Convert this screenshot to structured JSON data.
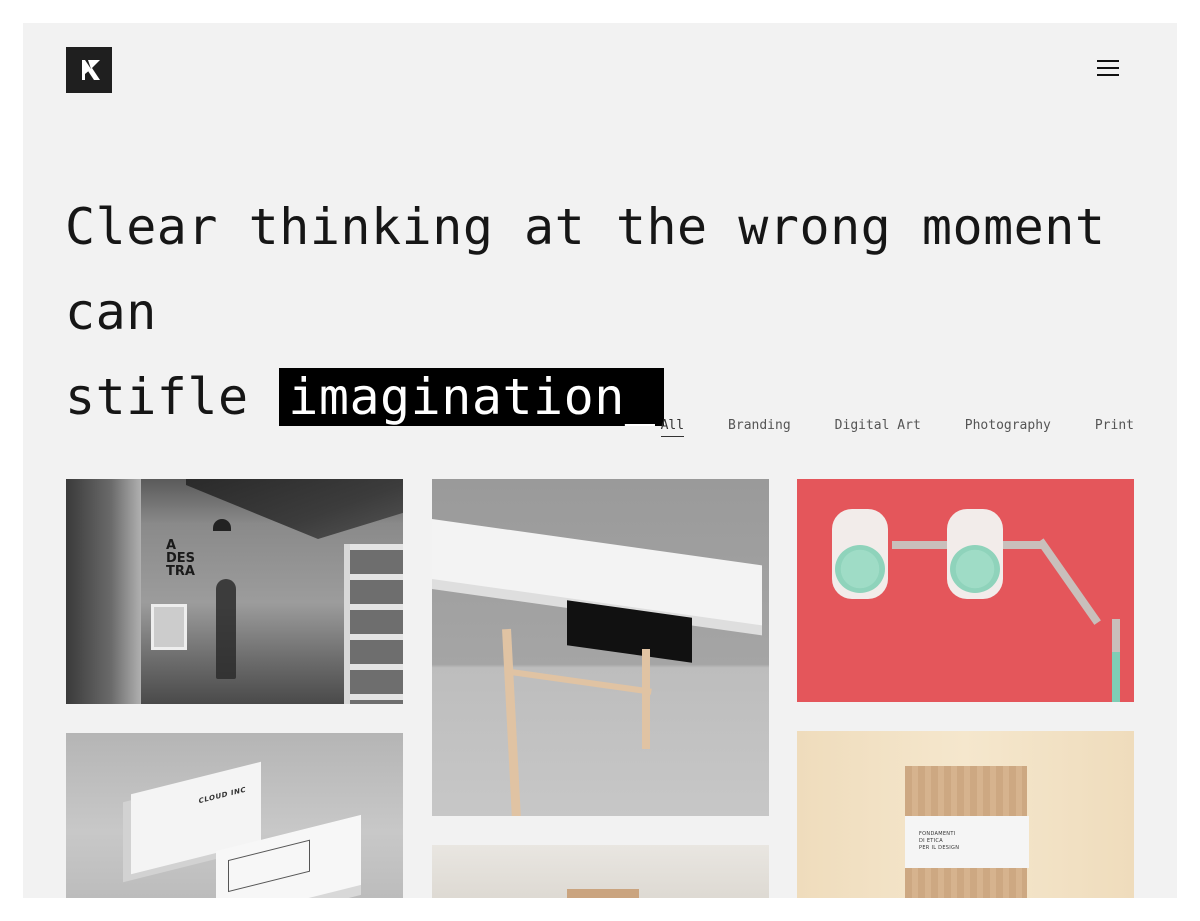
{
  "header": {
    "logo_letter": "K",
    "menu_icon": "hamburger-menu-icon"
  },
  "hero": {
    "line1": "Clear thinking at the wrong moment can",
    "line2_prefix": "stifle",
    "highlight": "imagination_"
  },
  "filters": {
    "items": [
      {
        "label": "All",
        "active": true
      },
      {
        "label": "Branding",
        "active": false
      },
      {
        "label": "Digital Art",
        "active": false
      },
      {
        "label": "Photography",
        "active": false
      },
      {
        "label": "Print",
        "active": false
      }
    ]
  },
  "portfolio": {
    "tiles": [
      {
        "subject": "black-and-white studio office",
        "wordmark": "A\nDES\nTRA"
      },
      {
        "subject": "white desk with wooden legs"
      },
      {
        "subject": "mint speakers on red background"
      },
      {
        "subject": "business cards mockup",
        "card_text": "CLOUD INC"
      },
      {
        "subject": "plaster wall with wooden object"
      },
      {
        "subject": "wooden bound book",
        "book_text": "FONDAMENTI\nDI ETICA\nPER IL DESIGN"
      }
    ]
  },
  "colors": {
    "page_bg": "#ffffff",
    "frame_bg": "#f2f2f2",
    "text": "#161616",
    "highlight_bg": "#000000",
    "filter_text": "#555555",
    "accent_red": "#e4565b",
    "accent_mint": "#9fdcc6"
  }
}
